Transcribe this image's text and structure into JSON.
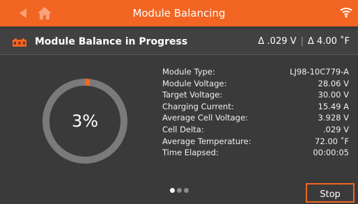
{
  "topbar": {
    "title": "Module Balancing",
    "back_icon": "back-arrow-icon",
    "home_icon": "home-icon",
    "wifi_icon": "wifi-icon",
    "color": "#f26522"
  },
  "status": {
    "icon": "module-icon",
    "title": "Module Balance in Progress",
    "delta_voltage": "Δ .029 V",
    "separator": "|",
    "delta_temperature": "Δ 4.00 ˚F"
  },
  "progress": {
    "percent_label": "3%",
    "value": 3,
    "ring_color": "#7a7a7a",
    "fill_color": "#f26522"
  },
  "info": [
    {
      "label": "Module Type:",
      "value": "LJ98-10C779-A"
    },
    {
      "label": "Module Voltage:",
      "value": "28.06 V"
    },
    {
      "label": "Target Voltage:",
      "value": "30.00 V"
    },
    {
      "label": "Charging Current:",
      "value": "15.49 A"
    },
    {
      "label": "Average Cell Voltage:",
      "value": "3.928 V"
    },
    {
      "label": "Cell Delta:",
      "value": ".029 V"
    },
    {
      "label": "Average Temperature:",
      "value": "72.00 ˚F"
    },
    {
      "label": "Time Elapsed:",
      "value": "00:00:05"
    }
  ],
  "pagination": {
    "total": 3,
    "active": 1
  },
  "actions": {
    "stop_label": "Stop"
  }
}
